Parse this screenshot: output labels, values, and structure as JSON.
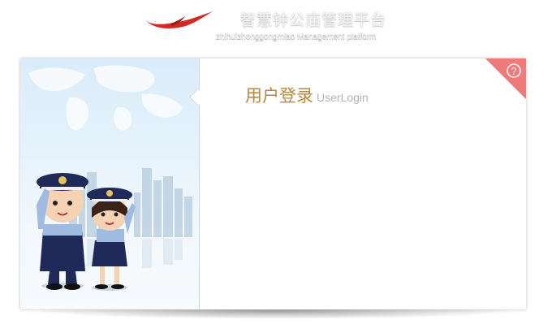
{
  "header": {
    "title_cn": "智慧钟公庙管理平台",
    "title_en": "zhihuizhonggongmiao Management platform",
    "logo_icon": "red-ribbon-logo-icon"
  },
  "login": {
    "title_cn": "用户登录",
    "title_en": "UserLogin"
  },
  "help": {
    "icon": "help-question-icon",
    "symbol": "?"
  },
  "illustration": {
    "icon": "police-officers-saluting-icon"
  },
  "colors": {
    "accent": "#b5883c",
    "corner": "#f17b7b",
    "logo": "#d22a22",
    "panel": "#e6f2fb"
  }
}
